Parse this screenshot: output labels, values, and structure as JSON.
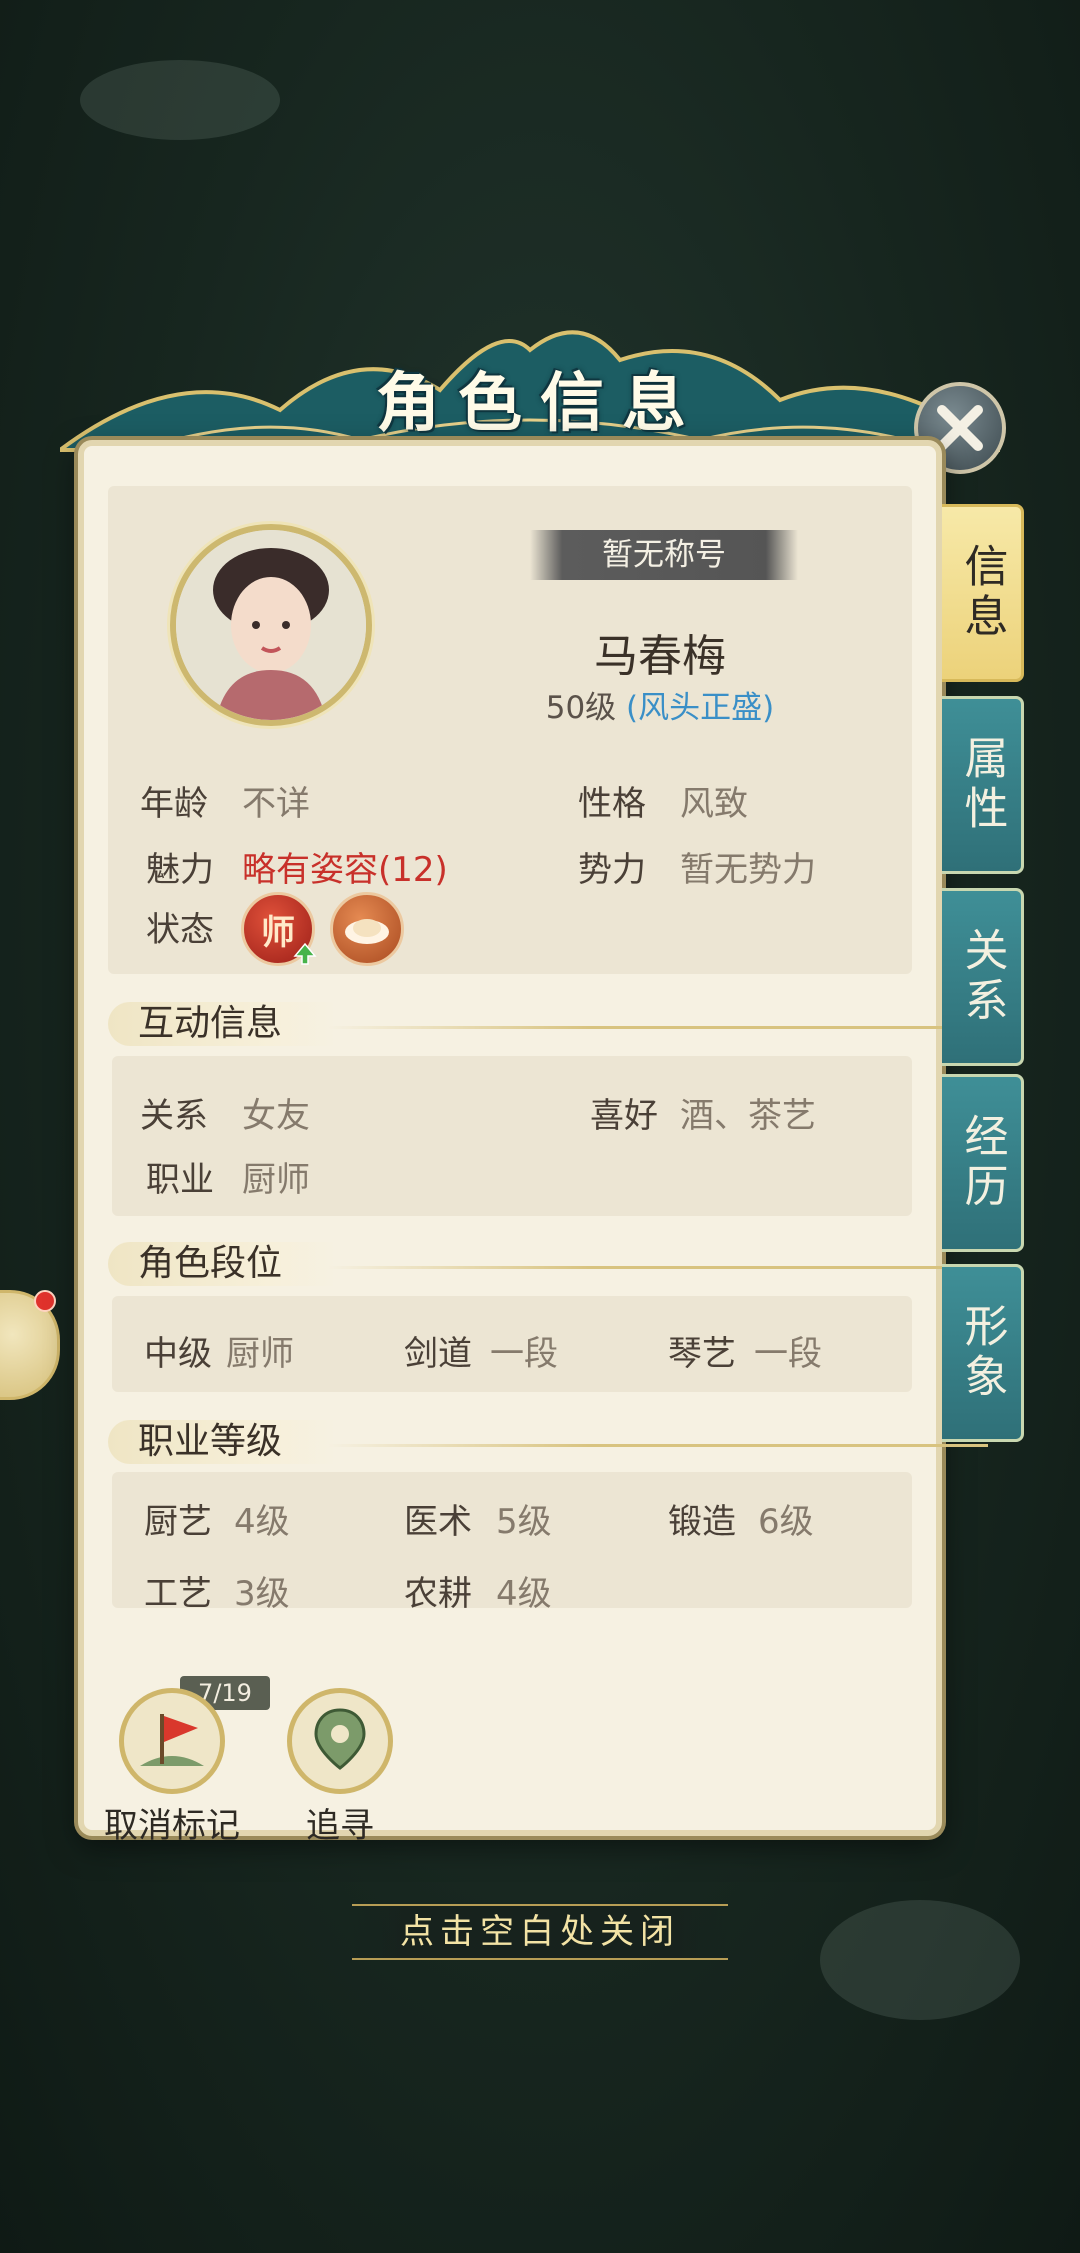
{
  "window": {
    "title": "角色信息"
  },
  "hint": "点击空白处关闭",
  "profile": {
    "title_tag": "暂无称号",
    "name": "马春梅",
    "level": "50级",
    "fame": "(风头正盛)"
  },
  "basic": {
    "age_label": "年龄",
    "age_value": "不详",
    "personality_label": "性格",
    "personality_value": "风致",
    "charm_label": "魅力",
    "charm_value": "略有姿容(12)",
    "faction_label": "势力",
    "faction_value": "暂无势力",
    "status_label": "状态",
    "status_badges": [
      {
        "icon": "master-badge-icon",
        "text": "师"
      },
      {
        "icon": "food-badge-icon",
        "text": ""
      }
    ]
  },
  "interaction": {
    "header": "互动信息",
    "relation_label": "关系",
    "relation_value": "女友",
    "hobby_label": "喜好",
    "hobby_value": "酒、茶艺",
    "job_label": "职业",
    "job_value": "厨师"
  },
  "rank": {
    "header": "角色段位",
    "items": [
      {
        "label": "中级",
        "value": "厨师"
      },
      {
        "label": "剑道",
        "value": "一段"
      },
      {
        "label": "琴艺",
        "value": "一段"
      }
    ]
  },
  "skills": {
    "header": "职业等级",
    "items": [
      {
        "label": "厨艺",
        "value": "4级"
      },
      {
        "label": "医术",
        "value": "5级"
      },
      {
        "label": "锻造",
        "value": "6级"
      },
      {
        "label": "工艺",
        "value": "3级"
      },
      {
        "label": "农耕",
        "value": "4级"
      }
    ]
  },
  "tabs": [
    {
      "label": "信息",
      "active": true
    },
    {
      "label": "属性",
      "active": false
    },
    {
      "label": "关系",
      "active": false
    },
    {
      "label": "经历",
      "active": false
    },
    {
      "label": "形象",
      "active": false
    }
  ],
  "actions": {
    "counter": "7/19",
    "unmark_label": "取消标记",
    "track_label": "追寻"
  },
  "colors": {
    "panel": "#f6f1e2",
    "tab_teal": "#3f8f97",
    "tab_active": "#f0da85",
    "fame_blue": "#3a8fc7",
    "charm_red": "#c8302a"
  }
}
